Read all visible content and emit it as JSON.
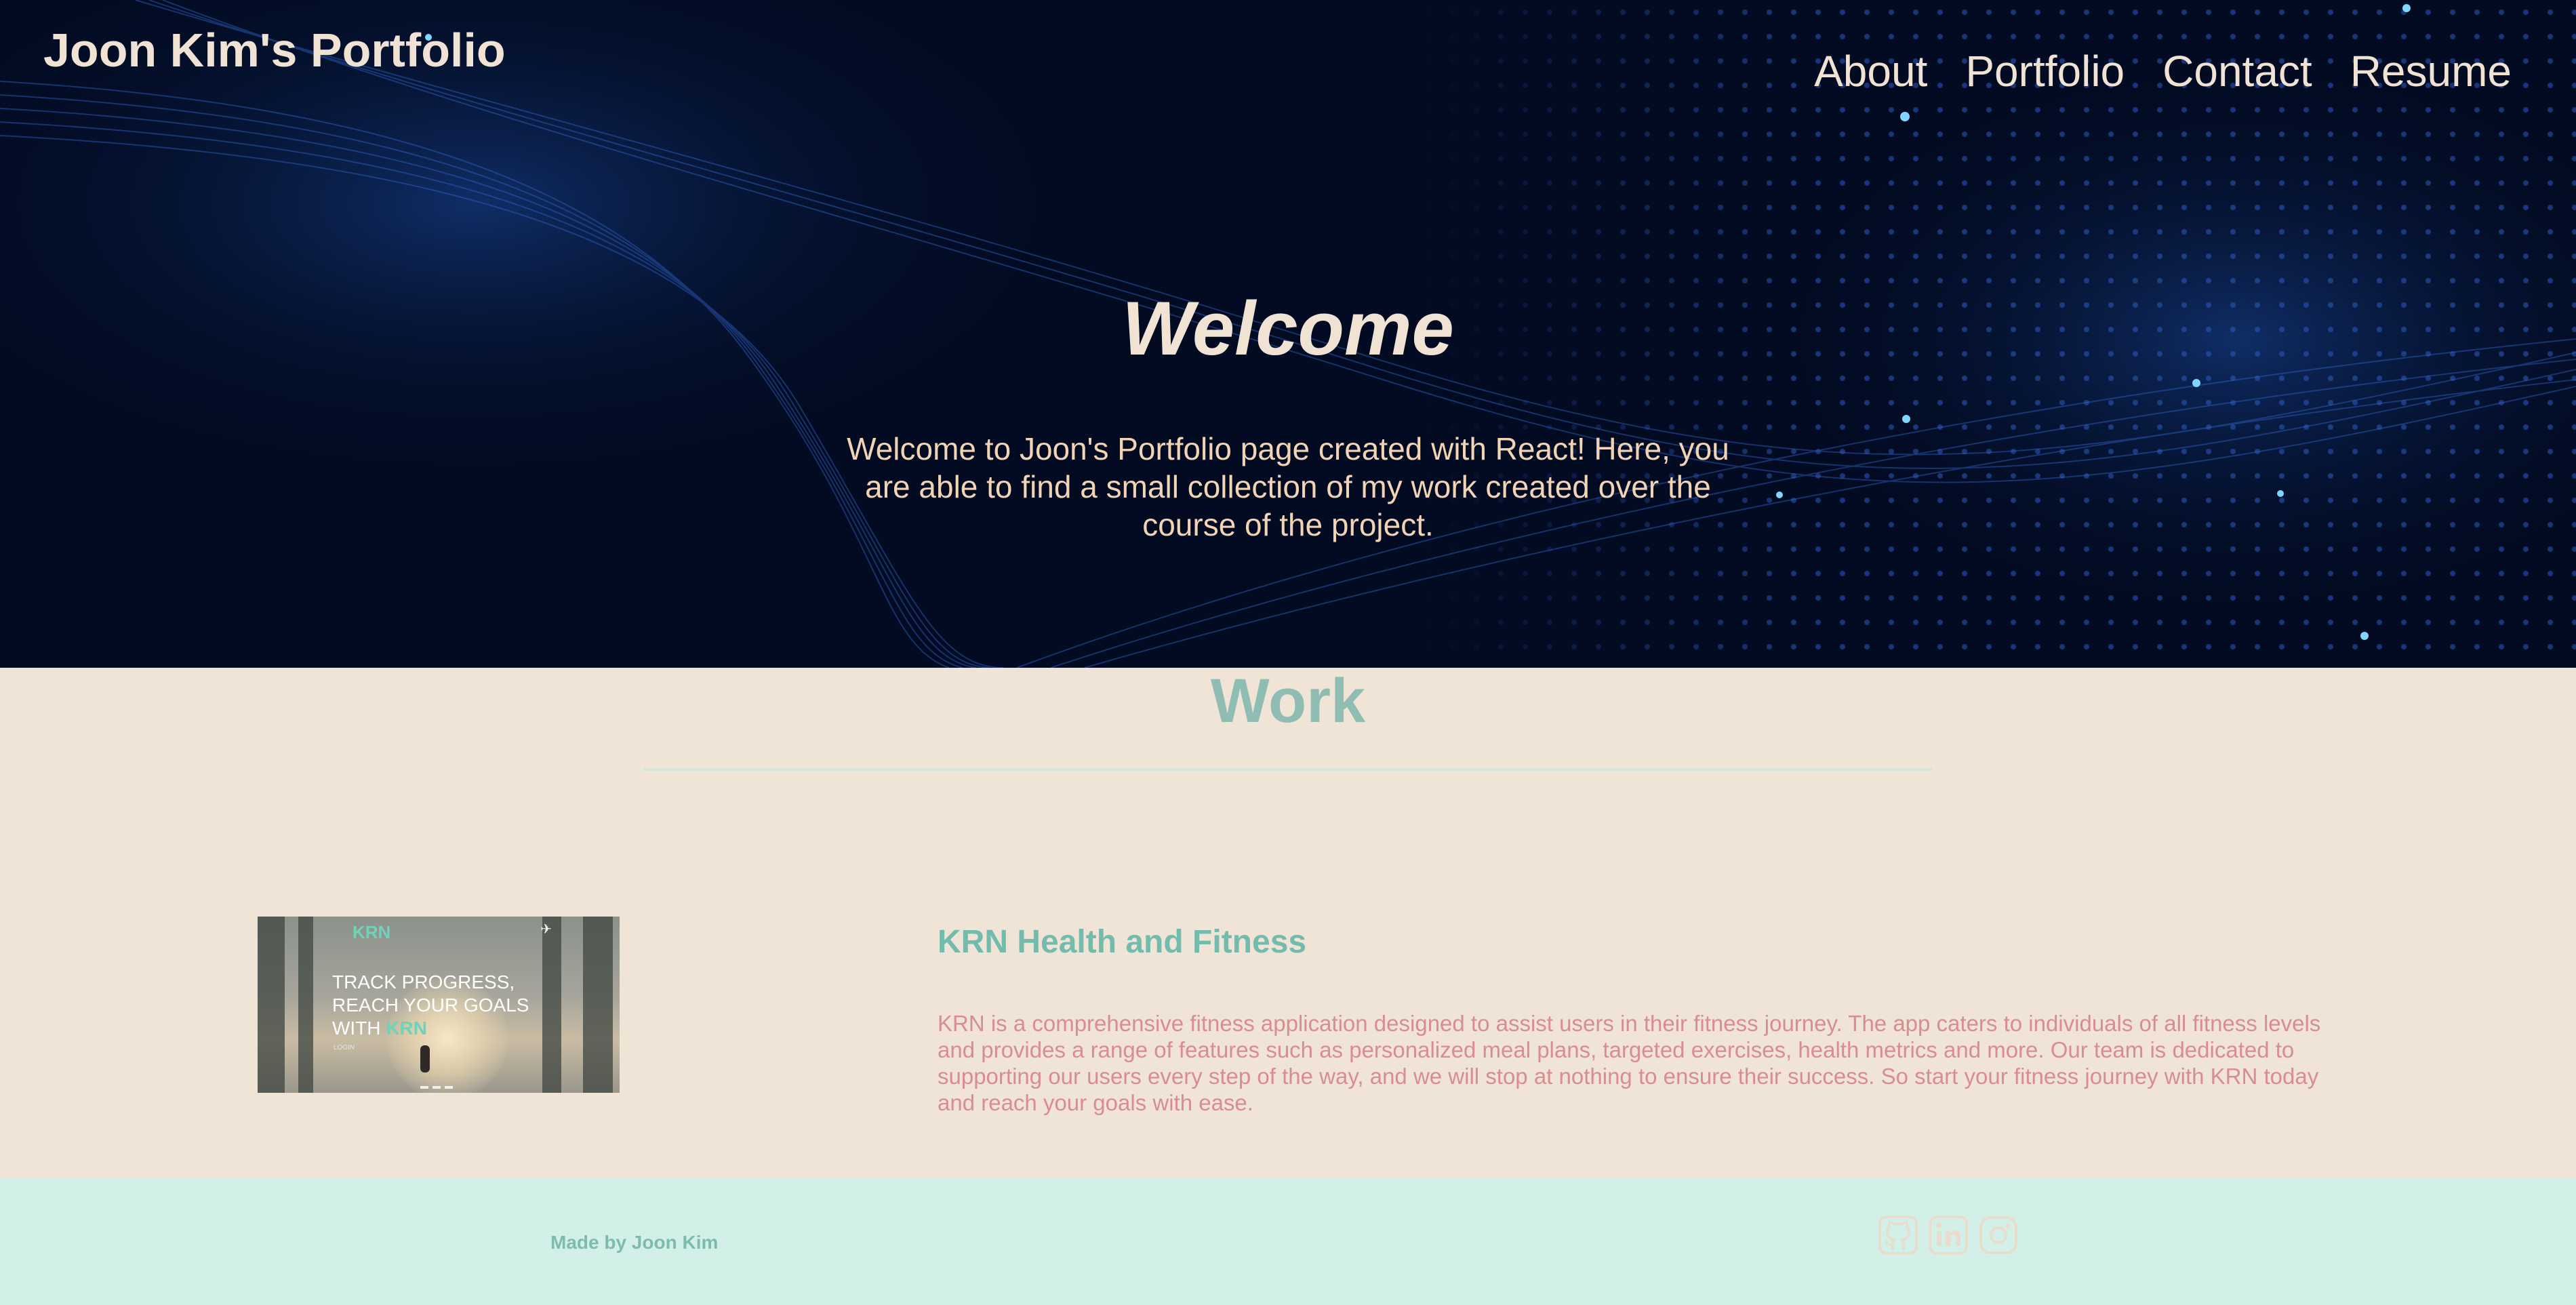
{
  "header": {
    "site_title": "Joon Kim's Portfolio",
    "nav": [
      {
        "label": "About"
      },
      {
        "label": "Portfolio"
      },
      {
        "label": "Contact"
      },
      {
        "label": "Resume"
      }
    ]
  },
  "hero": {
    "heading": "Welcome",
    "text": "Welcome to Joon's Portfolio page created with React! Here, you are able to find a small collection of my work created over the course of the project."
  },
  "work": {
    "heading": "Work",
    "projects": [
      {
        "title": "KRN Health and Fitness",
        "description": "KRN is a comprehensive fitness application designed to assist users in their fitness journey. The app caters to individuals of all fitness levels and provides a range of features such as personalized meal plans, targeted exercises, health metrics and more. Our team is dedicated to supporting our users every step of the way, and we will stop at nothing to ensure their success. So start your fitness journey with KRN today and reach your goals with ease.",
        "thumbnail": {
          "logo": "KRN",
          "headline_lines": [
            "TRACK PROGRESS,",
            "REACH YOUR GOALS",
            "WITH"
          ],
          "headline_highlight": "KRN",
          "login_text": "LOGIN"
        }
      }
    ]
  },
  "footer": {
    "credit": "Made by Joon Kim",
    "social_icons": [
      "github-icon",
      "linkedin-icon",
      "instagram-icon"
    ]
  },
  "colors": {
    "hero_background": "#020b22",
    "page_background": "#f0e4d6",
    "footer_background": "#d3f0e8",
    "accent_teal": "#72bcae",
    "accent_pink": "#d88d92",
    "light_text": "#f1e3d3"
  }
}
